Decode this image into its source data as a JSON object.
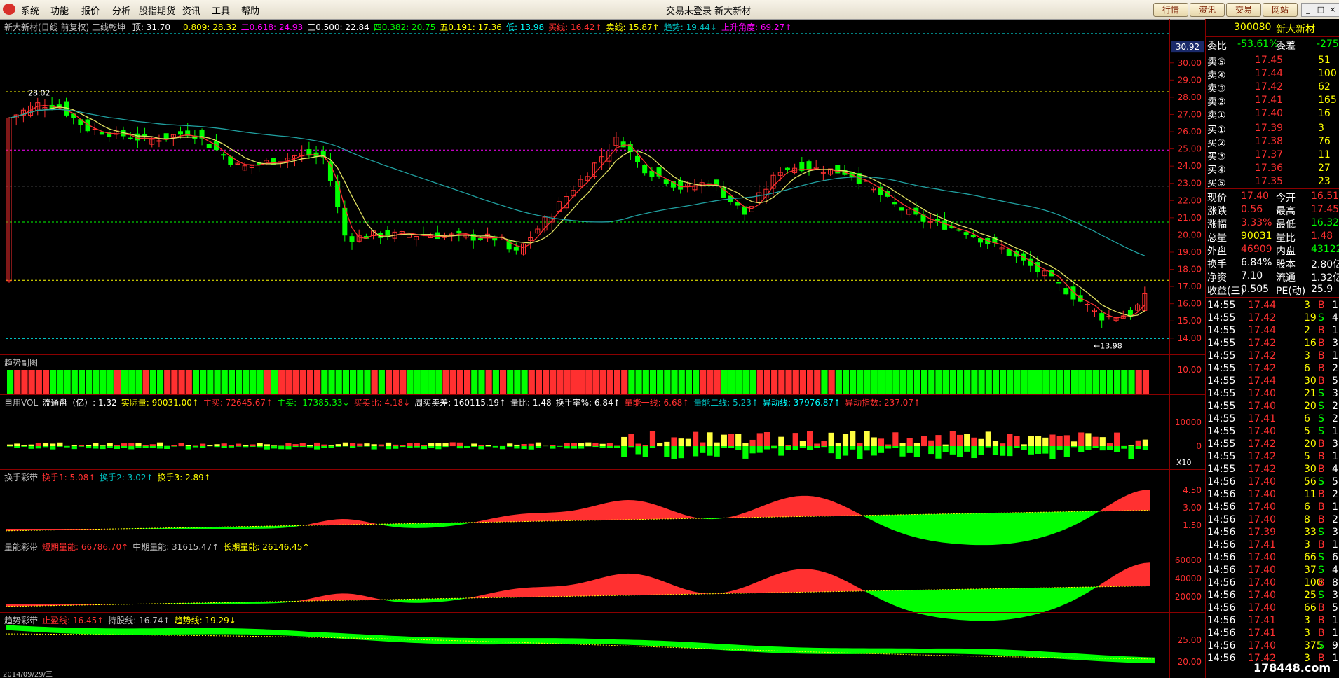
{
  "menubar": {
    "items": [
      "系统",
      "功能",
      "报价",
      "分析",
      "股指期货",
      "资讯",
      "工具",
      "帮助"
    ],
    "center_text": "交易未登录  新大新材",
    "right_buttons": [
      "行情",
      "资讯",
      "交易",
      "网站"
    ],
    "window_controls": [
      "_",
      "□",
      "×"
    ]
  },
  "main": {
    "title": "新大新材(日线 前复权) 三线乾坤",
    "indicators": [
      {
        "label": "顶: 31.70",
        "color": "#ffffff"
      },
      {
        "label": "一0.809: 28.32",
        "color": "#ffff00"
      },
      {
        "label": "二0.618: 24.93",
        "color": "#ff00ff"
      },
      {
        "label": "三0.500: 22.84",
        "color": "#ffffff"
      },
      {
        "label": "四0.382: 20.75",
        "color": "#00ff00"
      },
      {
        "label": "五0.191: 17.36",
        "color": "#ffff00"
      },
      {
        "label": "低: 13.98",
        "color": "#00ffff"
      },
      {
        "label": "买线: 16.42↑",
        "color": "#ff3030"
      },
      {
        "label": "卖线: 15.87↑",
        "color": "#ffff00"
      },
      {
        "label": "趋势: 19.44↓",
        "color": "#00c0c0"
      },
      {
        "label": "上升角度: 69.27↑",
        "color": "#ff00ff"
      }
    ],
    "price_ticks": [
      "30.00",
      "29.00",
      "28.00",
      "27.00",
      "26.00",
      "25.00",
      "24.00",
      "23.00",
      "22.00",
      "21.00",
      "20.00",
      "19.00",
      "18.00",
      "17.00",
      "16.00",
      "15.00",
      "14.00"
    ],
    "current_price_tag": "30.92",
    "annotations": {
      "high": "28.02",
      "low": "←13.98"
    },
    "levels": [
      {
        "price": 31.7,
        "color": "#00ffff"
      },
      {
        "price": 28.32,
        "color": "#ffff00"
      },
      {
        "price": 24.93,
        "color": "#ff00ff"
      },
      {
        "price": 22.84,
        "color": "#ffffff"
      },
      {
        "price": 20.75,
        "color": "#00ff00"
      },
      {
        "price": 17.36,
        "color": "#ffff00"
      },
      {
        "price": 13.98,
        "color": "#00ffff"
      }
    ]
  },
  "panel_trend": {
    "title": "趋势副图",
    "tick": "10.00"
  },
  "panel_vol": {
    "legend": [
      {
        "label": "自用VOL",
        "color": "#c0c0c0"
      },
      {
        "label": "流通盘（亿）: 1.32",
        "color": "#ffffff"
      },
      {
        "label": "实际量: 90031.00↑",
        "color": "#ffff00"
      },
      {
        "label": "主买: 72645.67↑",
        "color": "#ff3030"
      },
      {
        "label": "主卖: -17385.33↓",
        "color": "#00ff00"
      },
      {
        "label": "买卖比: 4.18↓",
        "color": "#ff3030"
      },
      {
        "label": "周买卖差: 160115.19↑",
        "color": "#ffffff"
      },
      {
        "label": "量比: 1.48",
        "color": "#ffffff"
      },
      {
        "label": "换手率%: 6.84↑",
        "color": "#ffffff"
      },
      {
        "label": "量能一线: 6.68↑",
        "color": "#ff3030"
      },
      {
        "label": "量能二线: 5.23↑",
        "color": "#00c0c0"
      },
      {
        "label": "异动线: 37976.87↑",
        "color": "#00ffff"
      },
      {
        "label": "异动指数: 237.07↑",
        "color": "#ff3030"
      }
    ],
    "ticks": [
      "10000",
      "0"
    ],
    "x10": "X10"
  },
  "panel_turnover": {
    "legend": [
      {
        "label": "换手彩带",
        "color": "#c0c0c0"
      },
      {
        "label": "换手1: 5.08↑",
        "color": "#ff3030"
      },
      {
        "label": "换手2: 3.02↑",
        "color": "#00c0c0"
      },
      {
        "label": "换手3: 2.89↑",
        "color": "#ffff00"
      }
    ],
    "ticks": [
      "4.50",
      "3.00",
      "1.50"
    ]
  },
  "panel_energy": {
    "legend": [
      {
        "label": "量能彩带",
        "color": "#c0c0c0"
      },
      {
        "label": "短期量能: 66786.70↑",
        "color": "#ff3030"
      },
      {
        "label": "中期量能: 31615.47↑",
        "color": "#c0c0c0"
      },
      {
        "label": "长期量能: 26146.45↑",
        "color": "#ffff00"
      }
    ],
    "ticks": [
      "60000",
      "40000",
      "20000"
    ]
  },
  "panel_band": {
    "legend": [
      {
        "label": "趋势彩带",
        "color": "#c0c0c0"
      },
      {
        "label": "止盈线: 16.45↑",
        "color": "#ff3030"
      },
      {
        "label": "持股线: 16.74↑",
        "color": "#c0c0c0"
      },
      {
        "label": "趋势线: 19.29↓",
        "color": "#ffff00"
      }
    ],
    "ticks": [
      "25.00",
      "20.00"
    ],
    "date_label": "2014/09/29/三"
  },
  "quote": {
    "code": "300080",
    "name": "新大新材",
    "weibi": {
      "label": "委比",
      "value": "-53.61%",
      "label2": "委差",
      "value2": "-275"
    },
    "asks": [
      {
        "label": "卖⑤",
        "price": "17.45",
        "vol": "51"
      },
      {
        "label": "卖④",
        "price": "17.44",
        "vol": "100"
      },
      {
        "label": "卖③",
        "price": "17.42",
        "vol": "62"
      },
      {
        "label": "卖②",
        "price": "17.41",
        "vol": "165"
      },
      {
        "label": "卖①",
        "price": "17.40",
        "vol": "16"
      }
    ],
    "bids": [
      {
        "label": "买①",
        "price": "17.39",
        "vol": "3"
      },
      {
        "label": "买②",
        "price": "17.38",
        "vol": "76"
      },
      {
        "label": "买③",
        "price": "17.37",
        "vol": "11"
      },
      {
        "label": "买④",
        "price": "17.36",
        "vol": "27"
      },
      {
        "label": "买⑤",
        "price": "17.35",
        "vol": "23"
      }
    ],
    "stats": [
      {
        "l1": "现价",
        "v1": "17.40",
        "l2": "今开",
        "v2": "16.51",
        "c1": "#ff3030",
        "c2": "#ff3030"
      },
      {
        "l1": "涨跌",
        "v1": "0.56",
        "l2": "最高",
        "v2": "17.45",
        "c1": "#ff3030",
        "c2": "#ff3030"
      },
      {
        "l1": "涨幅",
        "v1": "3.33%",
        "l2": "最低",
        "v2": "16.32",
        "c1": "#ff3030",
        "c2": "#00ff00"
      },
      {
        "l1": "总量",
        "v1": "90031",
        "l2": "量比",
        "v2": "1.48",
        "c1": "#ffff00",
        "c2": "#ff3030"
      },
      {
        "l1": "外盘",
        "v1": "46909",
        "l2": "内盘",
        "v2": "43122",
        "c1": "#ff3030",
        "c2": "#00ff00"
      },
      {
        "l1": "换手",
        "v1": "6.84%",
        "l2": "股本",
        "v2": "2.80亿",
        "c1": "#ffffff",
        "c2": "#ffffff"
      },
      {
        "l1": "净资",
        "v1": "7.10",
        "l2": "流通",
        "v2": "1.32亿",
        "c1": "#ffffff",
        "c2": "#ffffff"
      },
      {
        "l1": "收益(三)",
        "v1": "0.505",
        "l2": "PE(动)",
        "v2": "25.9",
        "c1": "#ffffff",
        "c2": "#ffffff"
      }
    ],
    "ticks": [
      {
        "t": "14:55",
        "p": "17.44",
        "v": "3",
        "s": "B",
        "n": "1"
      },
      {
        "t": "14:55",
        "p": "17.42",
        "v": "19",
        "s": "S",
        "n": "4"
      },
      {
        "t": "14:55",
        "p": "17.44",
        "v": "2",
        "s": "B",
        "n": "1"
      },
      {
        "t": "14:55",
        "p": "17.42",
        "v": "16",
        "s": "B",
        "n": "3"
      },
      {
        "t": "14:55",
        "p": "17.42",
        "v": "3",
        "s": "B",
        "n": "1"
      },
      {
        "t": "14:55",
        "p": "17.42",
        "v": "6",
        "s": "B",
        "n": "2"
      },
      {
        "t": "14:55",
        "p": "17.44",
        "v": "30",
        "s": "B",
        "n": "5"
      },
      {
        "t": "14:55",
        "p": "17.40",
        "v": "21",
        "s": "S",
        "n": "3"
      },
      {
        "t": "14:55",
        "p": "17.40",
        "v": "20",
        "s": "S",
        "n": "2"
      },
      {
        "t": "14:55",
        "p": "17.41",
        "v": "6",
        "s": "S",
        "n": "2"
      },
      {
        "t": "14:55",
        "p": "17.40",
        "v": "5",
        "s": "S",
        "n": "1"
      },
      {
        "t": "14:55",
        "p": "17.42",
        "v": "20",
        "s": "B",
        "n": "3"
      },
      {
        "t": "14:55",
        "p": "17.42",
        "v": "5",
        "s": "B",
        "n": "1"
      },
      {
        "t": "14:55",
        "p": "17.42",
        "v": "30",
        "s": "B",
        "n": "4"
      },
      {
        "t": "14:56",
        "p": "17.40",
        "v": "56",
        "s": "S",
        "n": "5"
      },
      {
        "t": "14:56",
        "p": "17.40",
        "v": "11",
        "s": "B",
        "n": "2"
      },
      {
        "t": "14:56",
        "p": "17.40",
        "v": "6",
        "s": "B",
        "n": "1"
      },
      {
        "t": "14:56",
        "p": "17.40",
        "v": "8",
        "s": "B",
        "n": "2"
      },
      {
        "t": "14:56",
        "p": "17.39",
        "v": "33",
        "s": "S",
        "n": "3"
      },
      {
        "t": "14:56",
        "p": "17.41",
        "v": "3",
        "s": "B",
        "n": "1"
      },
      {
        "t": "14:56",
        "p": "17.40",
        "v": "66",
        "s": "S",
        "n": "6"
      },
      {
        "t": "14:56",
        "p": "17.40",
        "v": "37",
        "s": "S",
        "n": "4"
      },
      {
        "t": "14:56",
        "p": "17.40",
        "v": "100",
        "s": "B",
        "n": "8"
      },
      {
        "t": "14:56",
        "p": "17.40",
        "v": "25",
        "s": "S",
        "n": "3"
      },
      {
        "t": "14:56",
        "p": "17.40",
        "v": "66",
        "s": "B",
        "n": "5"
      },
      {
        "t": "14:56",
        "p": "17.41",
        "v": "3",
        "s": "B",
        "n": "1"
      },
      {
        "t": "14:56",
        "p": "17.41",
        "v": "3",
        "s": "B",
        "n": "1"
      },
      {
        "t": "14:56",
        "p": "17.40",
        "v": "375",
        "s": "S",
        "n": "9"
      },
      {
        "t": "14:56",
        "p": "17.42",
        "v": "3",
        "s": "B",
        "n": "1"
      }
    ]
  },
  "watermark": "178448.com",
  "colors": {
    "up": "#ff3030",
    "down": "#00ff00",
    "bg": "#000000",
    "grid": "#8b0000"
  }
}
